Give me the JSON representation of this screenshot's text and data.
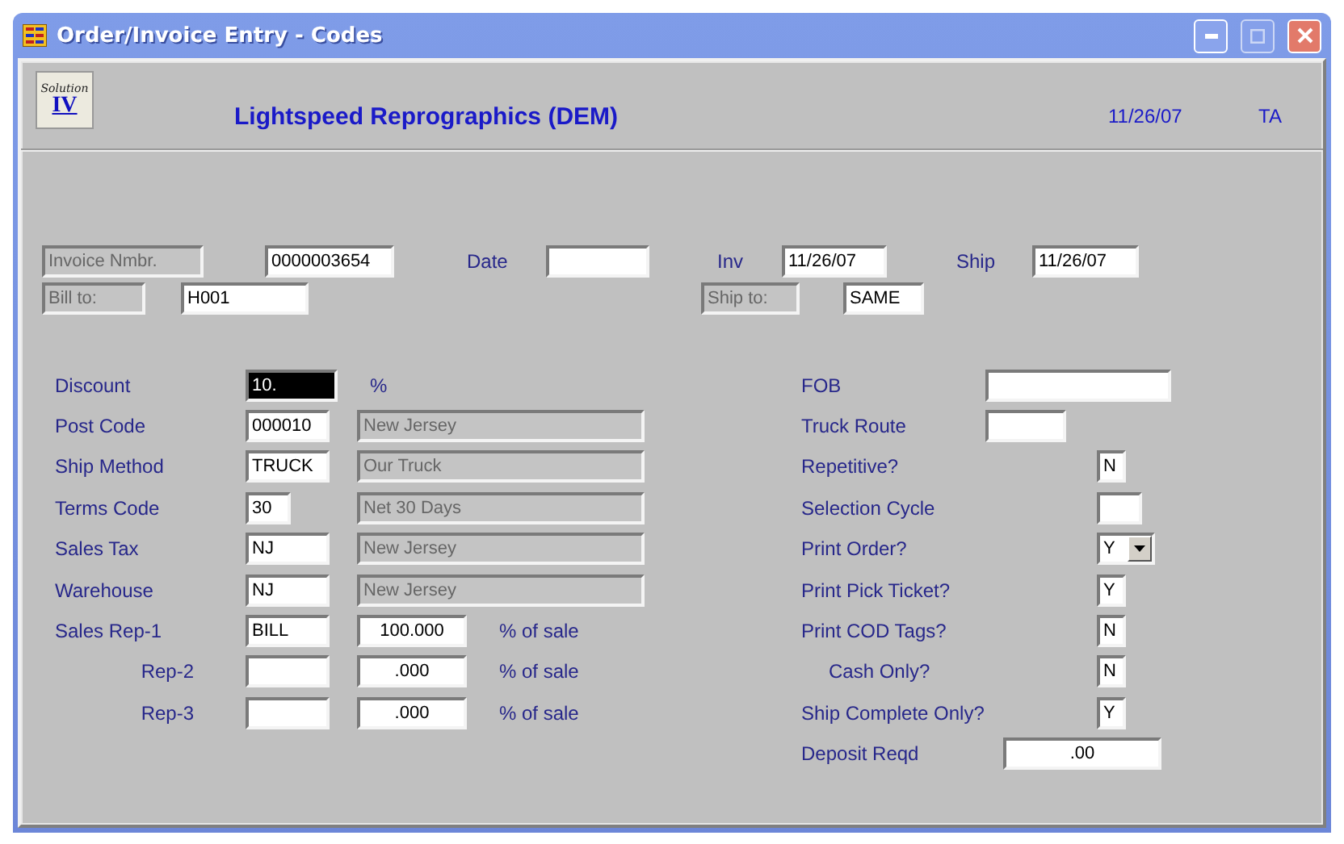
{
  "window": {
    "title": "Order/Invoice Entry - Codes"
  },
  "header": {
    "logo_script": "Solution",
    "logo_mark": "IV",
    "company": "Lightspeed Reprographics (DEM)",
    "date": "11/26/07",
    "user": "TA"
  },
  "top_rows": [
    [
      {
        "kind": "disabled",
        "value": "Invoice Nmbr."
      },
      {
        "kind": "field",
        "value": "0000003654"
      },
      {
        "kind": "label",
        "text": "Date"
      },
      {
        "kind": "field"
      },
      {
        "kind": "label",
        "text": "Inv"
      },
      {
        "kind": "field",
        "value": "11/26/07"
      },
      {
        "kind": "label",
        "text": "Ship"
      },
      {
        "kind": "field",
        "value": "11/26/07"
      }
    ],
    [
      {
        "kind": "disabled",
        "value": "Bill to:"
      },
      {
        "kind": "field",
        "value": "H001"
      },
      {
        "kind": "disabled",
        "value": "Ship to:"
      },
      {
        "kind": "field",
        "value": "SAME"
      }
    ]
  ],
  "left_rows": [
    {
      "kind": "unit",
      "label": "Discount",
      "value": "10.",
      "selected": true,
      "unit": "%"
    },
    {
      "kind": "lookup",
      "label": "Post Code",
      "value": "000010",
      "selected": false,
      "description": "New Jersey"
    },
    {
      "kind": "lookup",
      "label": "Ship Method",
      "value": "TRUCK",
      "selected": false,
      "description": "Our Truck"
    },
    {
      "kind": "lookup",
      "label": "Terms Code",
      "value": "30",
      "selected": false,
      "description": "Net 30 Days"
    },
    {
      "kind": "lookup",
      "label": "Sales Tax",
      "value": "NJ",
      "selected": false,
      "description": "New Jersey"
    },
    {
      "kind": "lookup",
      "label": "Warehouse",
      "value": "NJ",
      "selected": false,
      "description": "New Jersey"
    },
    {
      "kind": "rep",
      "label": "Sales Rep-1",
      "value": "BILL",
      "selected": false,
      "percent": "100.000",
      "unit": "% of sale"
    },
    {
      "kind": "sub_rep",
      "label": "Rep-2",
      "selected": false,
      "percent": ".000",
      "unit": "% of sale"
    },
    {
      "kind": "sub_rep",
      "label": "Rep-3",
      "selected": false,
      "percent": ".000",
      "unit": "% of sale"
    }
  ],
  "right_rows": [
    {
      "kind": "wide",
      "label": "FOB"
    },
    {
      "kind": "medium",
      "label": "Truck Route"
    },
    {
      "kind": "flag",
      "label": "Repetitive?",
      "value": "N"
    },
    {
      "kind": "cycle",
      "label": "Selection Cycle"
    },
    {
      "kind": "dropdown",
      "label": "Print Order?",
      "value": "Y"
    },
    {
      "kind": "flag",
      "label": "Print Pick Ticket?",
      "value": "Y"
    },
    {
      "kind": "flag",
      "label": "Print COD Tags?",
      "value": "N"
    },
    {
      "kind": "sub_flag",
      "label": "Cash Only?",
      "value": "N"
    },
    {
      "kind": "flag",
      "label": "Ship Complete Only?",
      "value": "Y"
    },
    {
      "kind": "amount",
      "label": "Deposit Reqd",
      "value": ".00"
    }
  ]
}
